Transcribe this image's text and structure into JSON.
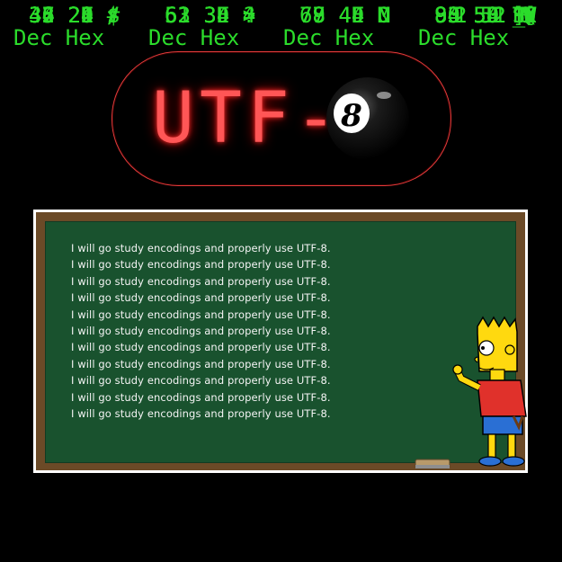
{
  "ascii_table": {
    "headers": [
      "Dec Hex",
      "Dec Hex",
      "Dec Hex",
      "Dec Hex"
    ],
    "rows": [
      [
        "32 20",
        "",
        "",
        "80 50 P"
      ],
      [
        "33 21",
        "",
        "",
        "1 51 Q"
      ],
      [
        "34 22",
        "",
        "",
        "2 52 R"
      ],
      [
        "35 23 #",
        "",
        "",
        "83 53 S"
      ],
      [
        "36 24 $",
        "52 34 4",
        "68 44 D",
        "84 54 T"
      ],
      [
        "",
        "",
        "",
        "U"
      ],
      [
        "",
        "",
        "",
        "V"
      ],
      [
        "",
        "",
        "",
        "W"
      ],
      [
        "",
        "",
        "",
        "X"
      ],
      [
        "",
        "",
        "",
        "Y"
      ],
      [
        "",
        "",
        "",
        "Z"
      ],
      [
        "",
        "",
        "",
        "["
      ],
      [
        "",
        "",
        "",
        "\\"
      ],
      [
        "45 2D -",
        "61 3D =",
        "77 4D M",
        "93 5D ]"
      ],
      [
        "46 2E .",
        "62 3E >",
        "78 4E N",
        "94 5E ^"
      ],
      [
        "47 2F /",
        "63 3F ?",
        "79 4F O",
        "95 5F _"
      ]
    ]
  },
  "badge": {
    "text": "UTF-",
    "ball_digit": "8"
  },
  "chalkboard": {
    "lines": [
      "I will go study encodings and properly use UTF-8.",
      "I will go study encodings and properly use UTF-8.",
      "I will go study encodings and properly use UTF-8.",
      "I will go study encodings and properly use UTF-8.",
      "I will go study encodings and properly use UTF-8.",
      "I will go study encodings and properly use UTF-8.",
      "I will go study encodings and properly use UTF-8.",
      "I will go study encodings and properly use UTF-8.",
      "I will go study encodings and properly use UTF-8.",
      "I will go study encodings and properly use UTF-8.",
      "I will go study encodings and properly use UTF-8."
    ]
  },
  "colors": {
    "terminal_green": "#2bdc2b",
    "neon_red": "#ff5656",
    "board_green": "#19522e",
    "frame_brown": "#6b4a27"
  }
}
